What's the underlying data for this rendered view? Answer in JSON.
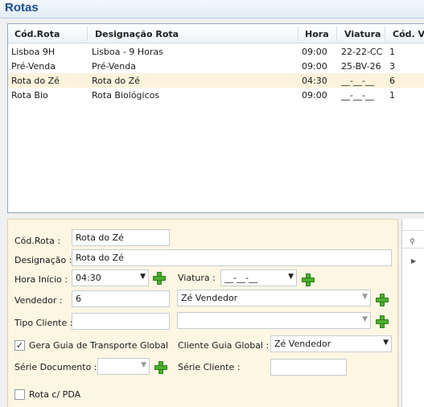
{
  "window": {
    "title": "Rotas"
  },
  "grid": {
    "columns": [
      "Cód.Rota",
      "Designação Rota",
      "Hora",
      "Viatura",
      "Cód. Ve"
    ],
    "rows": [
      [
        "Lisboa 9H",
        "Lisboa - 9 Horas",
        "09:00",
        "22-22-CC",
        "1"
      ],
      [
        "Pré-Venda",
        "Pré-Venda",
        "09:00",
        "25-BV-26",
        "3"
      ],
      [
        "Rota do Zé",
        "Rota do Zé",
        "04:30",
        "__-__-__",
        "6"
      ],
      [
        "Rota Bio",
        "Rota Biológicos",
        "09:00",
        "__-__-__",
        "1"
      ]
    ],
    "selected_row": 2
  },
  "form": {
    "cod_rota_label": "Cód.Rota :",
    "cod_rota_value": "Rota do Zé",
    "designacao_label": "Designação :",
    "designacao_value": "Rota do Zé",
    "hora_inicio_label": "Hora Início :",
    "hora_inicio_value": "04:30",
    "viatura_label": "Viatura :",
    "viatura_value": "__-__-__",
    "vendedor_label": "Vendedor :",
    "vendedor_code": "6",
    "vendedor_name": "Zé Vendedor",
    "tipo_cliente_label": "Tipo Cliente :",
    "tipo_cliente_code": "",
    "tipo_cliente_name": "",
    "gera_guia_label": "Gera Guia de Transporte Global",
    "gera_guia_checked": true,
    "cliente_guia_label": "Cliente Guia Global :",
    "cliente_guia_value": "Zé Vendedor",
    "serie_documento_label": "Série Documento :",
    "serie_documento_value": "",
    "serie_cliente_label": "Série Cliente :",
    "serie_cliente_value": "",
    "rota_pda_label": "Rota c/ PDA",
    "rota_pda_checked": false
  },
  "icons": {
    "add": "plus-icon",
    "dropdown": "chevron-down-icon",
    "checkmark": "✓",
    "arrow_glyph": "▼",
    "pin_glyph": "⚲",
    "expand_glyph": "▶"
  },
  "colors": {
    "title": "#1b4f8f",
    "selected_row": "#fdf3dc",
    "panel_bg": "#fdf6e3",
    "add_icon": "#4caf2f"
  }
}
